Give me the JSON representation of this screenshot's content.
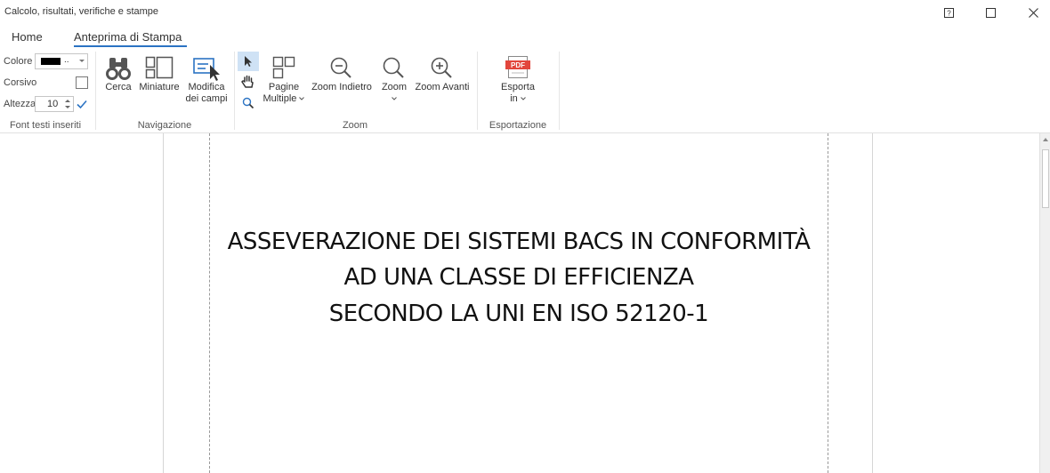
{
  "window": {
    "title": "Calcolo, risultati, verifiche e stampe",
    "buttons": [
      "help-icon",
      "maximize-icon",
      "close-icon"
    ]
  },
  "tabs": [
    {
      "label": "Home",
      "active": false
    },
    {
      "label": "Anteprima di Stampa",
      "active": true
    }
  ],
  "ribbon": {
    "font_group": {
      "label": "Font testi inseriti",
      "colore_label": "Colore",
      "colore_value": "#000000",
      "colore_dots": "..",
      "corsivo_label": "Corsivo",
      "corsivo_checked": false,
      "altezza_label": "Altezza",
      "altezza_value": "10"
    },
    "navigazione": {
      "label": "Navigazione",
      "cerca": "Cerca",
      "miniature": "Miniature",
      "modifica_1": "Modifica",
      "modifica_2": "dei campi"
    },
    "zoom": {
      "label": "Zoom",
      "pagine_1": "Pagine",
      "pagine_2": "Multiple",
      "zoom_indietro": "Zoom Indietro",
      "zoom": "Zoom",
      "zoom_avanti": "Zoom Avanti"
    },
    "esportazione": {
      "label": "Esportazione",
      "esporta_1": "Esporta",
      "esporta_2": "in",
      "pdf_badge": "PDF"
    }
  },
  "document": {
    "heading_lines": [
      "ASSEVERAZIONE DEI SISTEMI BACS IN CONFORMITÀ",
      "AD UNA CLASSE DI EFFICIENZA",
      "SECONDO LA UNI EN ISO 52120-1"
    ]
  },
  "colors": {
    "accent": "#2b73c3",
    "pdf_red": "#e2463c"
  }
}
